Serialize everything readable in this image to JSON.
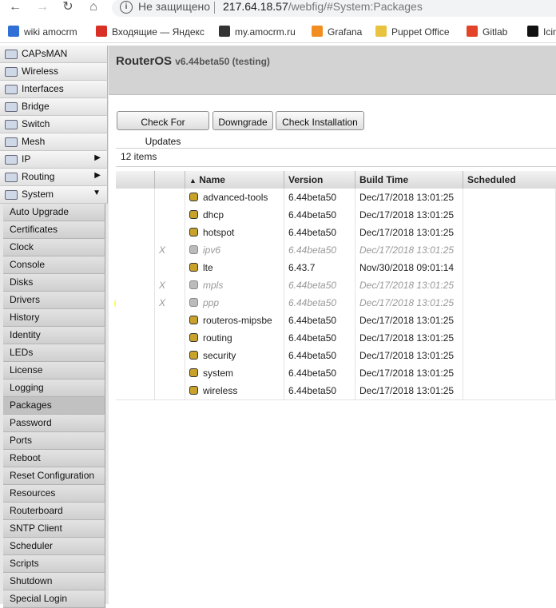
{
  "browser": {
    "security_label": "Не защищено",
    "url_host": "217.64.18.57",
    "url_path": "/webfig/#System:Packages",
    "bookmarks": [
      {
        "label": "wiki amocrm",
        "icon": "amocrm-icon",
        "color": "#2f6fd6"
      },
      {
        "label": "Входящие — Яндекс",
        "icon": "gmail-icon",
        "color": "#d93025"
      },
      {
        "label": "my.amocrm.ru",
        "icon": "arrow-circle-icon",
        "color": "#333333"
      },
      {
        "label": "Grafana",
        "icon": "grafana-icon",
        "color": "#f28d22"
      },
      {
        "label": "Puppet Office",
        "icon": "puppet-icon",
        "color": "#e8c340"
      },
      {
        "label": "Gitlab",
        "icon": "gitlab-icon",
        "color": "#e24329"
      },
      {
        "label": "Icin",
        "icon": "icinga-icon",
        "color": "#111111"
      }
    ]
  },
  "menu": {
    "items": [
      {
        "label": "CAPsMAN",
        "icon": "capsman-icon",
        "arrow": ""
      },
      {
        "label": "Wireless",
        "icon": "wireless-icon",
        "arrow": ""
      },
      {
        "label": "Interfaces",
        "icon": "interfaces-icon",
        "arrow": ""
      },
      {
        "label": "Bridge",
        "icon": "bridge-icon",
        "arrow": ""
      },
      {
        "label": "Switch",
        "icon": "switch-icon",
        "arrow": ""
      },
      {
        "label": "Mesh",
        "icon": "mesh-icon",
        "arrow": ""
      },
      {
        "label": "IP",
        "icon": "ip-icon",
        "arrow": "▶"
      },
      {
        "label": "Routing",
        "icon": "routing-icon",
        "arrow": "▶"
      },
      {
        "label": "System",
        "icon": "system-gear-icon",
        "arrow": "▼"
      }
    ],
    "sub_items": [
      "Auto Upgrade",
      "Certificates",
      "Clock",
      "Console",
      "Disks",
      "Drivers",
      "History",
      "Identity",
      "LEDs",
      "License",
      "Logging",
      "Packages",
      "Password",
      "Ports",
      "Reboot",
      "Reset Configuration",
      "Resources",
      "Routerboard",
      "SNTP Client",
      "Scheduler",
      "Scripts",
      "Shutdown",
      "Special Login"
    ],
    "active_sub": "Packages"
  },
  "header": {
    "title": "RouterOS",
    "version": "v6.44beta50 (testing)"
  },
  "toolbar": {
    "check_updates": "Check For Updates",
    "downgrade": "Downgrade",
    "check_installation": "Check Installation"
  },
  "items_count": "12 items",
  "table": {
    "columns": {
      "name": "Name",
      "version": "Version",
      "build_time": "Build Time",
      "scheduled": "Scheduled"
    },
    "sort_indicator": "▲",
    "rows": [
      {
        "flag": "",
        "name": "advanced-tools",
        "version": "6.44beta50",
        "build_time": "Dec/17/2018 13:01:25",
        "scheduled": "",
        "disabled": false
      },
      {
        "flag": "",
        "name": "dhcp",
        "version": "6.44beta50",
        "build_time": "Dec/17/2018 13:01:25",
        "scheduled": "",
        "disabled": false
      },
      {
        "flag": "",
        "name": "hotspot",
        "version": "6.44beta50",
        "build_time": "Dec/17/2018 13:01:25",
        "scheduled": "",
        "disabled": false
      },
      {
        "flag": "X",
        "name": "ipv6",
        "version": "6.44beta50",
        "build_time": "Dec/17/2018 13:01:25",
        "scheduled": "",
        "disabled": true
      },
      {
        "flag": "",
        "name": "lte",
        "version": "6.43.7",
        "build_time": "Nov/30/2018 09:01:14",
        "scheduled": "",
        "disabled": false
      },
      {
        "flag": "X",
        "name": "mpls",
        "version": "6.44beta50",
        "build_time": "Dec/17/2018 13:01:25",
        "scheduled": "",
        "disabled": true
      },
      {
        "flag": "X",
        "name": "ppp",
        "version": "6.44beta50",
        "build_time": "Dec/17/2018 13:01:25",
        "scheduled": "",
        "disabled": true
      },
      {
        "flag": "",
        "name": "routeros-mipsbe",
        "version": "6.44beta50",
        "build_time": "Dec/17/2018 13:01:25",
        "scheduled": "",
        "disabled": false
      },
      {
        "flag": "",
        "name": "routing",
        "version": "6.44beta50",
        "build_time": "Dec/17/2018 13:01:25",
        "scheduled": "",
        "disabled": false
      },
      {
        "flag": "",
        "name": "security",
        "version": "6.44beta50",
        "build_time": "Dec/17/2018 13:01:25",
        "scheduled": "",
        "disabled": false
      },
      {
        "flag": "",
        "name": "system",
        "version": "6.44beta50",
        "build_time": "Dec/17/2018 13:01:25",
        "scheduled": "",
        "disabled": false
      },
      {
        "flag": "",
        "name": "wireless",
        "version": "6.44beta50",
        "build_time": "Dec/17/2018 13:01:25",
        "scheduled": "",
        "disabled": false
      }
    ]
  },
  "highlight": {
    "row": "ppp",
    "color": "#ffff00"
  }
}
